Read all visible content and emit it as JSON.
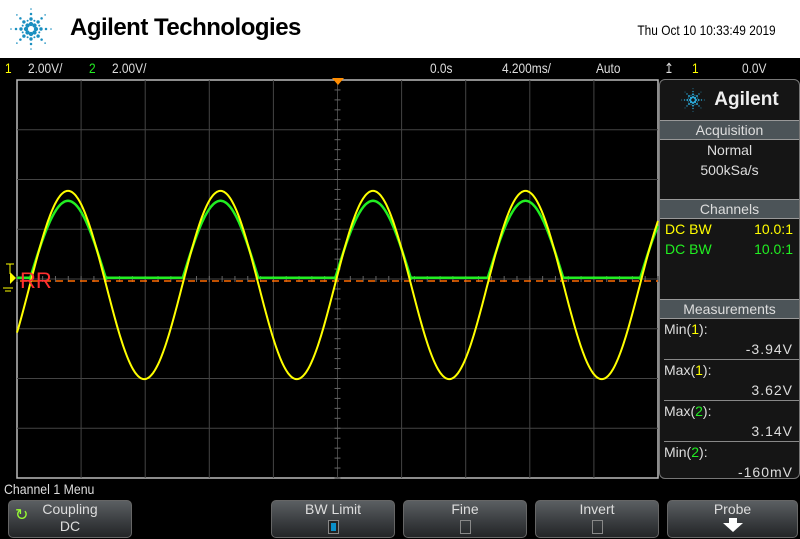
{
  "header": {
    "brand": "Agilent Technologies",
    "datetime": "Thu Oct 10 10:33:49 2019"
  },
  "status": {
    "ch1_num": "1",
    "ch1_scale": "2.00V/",
    "ch2_num": "2",
    "ch2_scale": "2.00V/",
    "delay": "0.0s",
    "timebase": "4.200ms/",
    "trigger_mode": "Auto",
    "trigger_source": "1",
    "trigger_level": "0.0V"
  },
  "plot": {
    "ground_marker_label": "RR",
    "trace_colors": {
      "ch1": "#ffff00",
      "ch2": "#22ee22"
    },
    "ground_color": "#ff6a00"
  },
  "panel": {
    "brand": "Agilent",
    "acquisition_title": "Acquisition",
    "acq_mode": "Normal",
    "sample_rate": "500kSa/s",
    "channels_title": "Channels",
    "channels": [
      {
        "coupling": "DC BW",
        "probe": "10.0:1"
      },
      {
        "coupling": "DC BW",
        "probe": "10.0:1"
      }
    ],
    "measurements_title": "Measurements",
    "measurements": [
      {
        "name": "Min(",
        "ch": "1",
        "value": "-3.94V"
      },
      {
        "name": "Max(",
        "ch": "1",
        "value": "3.62V"
      },
      {
        "name": "Max(",
        "ch": "2",
        "value": "3.14V"
      },
      {
        "name": "Min(",
        "ch": "2",
        "value": "-160mV"
      }
    ]
  },
  "menu": {
    "title": "Channel 1 Menu",
    "coupling_label": "Coupling",
    "coupling_value": "DC",
    "bw_limit": "BW Limit",
    "bw_limit_on": true,
    "fine": "Fine",
    "fine_on": false,
    "invert": "Invert",
    "invert_on": false,
    "probe": "Probe"
  }
}
